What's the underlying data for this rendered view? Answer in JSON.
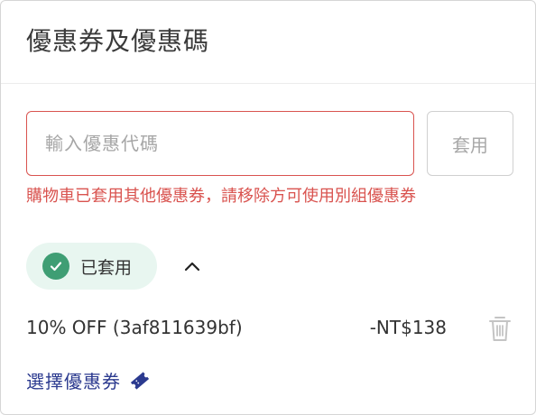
{
  "panel": {
    "title": "優惠券及優惠碼"
  },
  "coupon_form": {
    "input_placeholder": "輸入優惠代碼",
    "input_value": "",
    "apply_label": "套用",
    "error": "購物車已套用其他優惠券，請移除方可使用別組優惠券"
  },
  "applied": {
    "status_label": "已套用",
    "icon": "check-icon",
    "toggle_icon": "chevron-up-icon"
  },
  "coupon_item": {
    "name": "10% OFF (3af811639bf)",
    "amount": "-NT$138",
    "delete_icon": "trash-icon"
  },
  "select_coupon": {
    "label": "選擇優惠券",
    "icon": "ticket-icon"
  },
  "colors": {
    "error": "#d9534f",
    "success": "#3f9e74",
    "success_bg": "#e8f6f0",
    "link": "#2b3a8f"
  }
}
